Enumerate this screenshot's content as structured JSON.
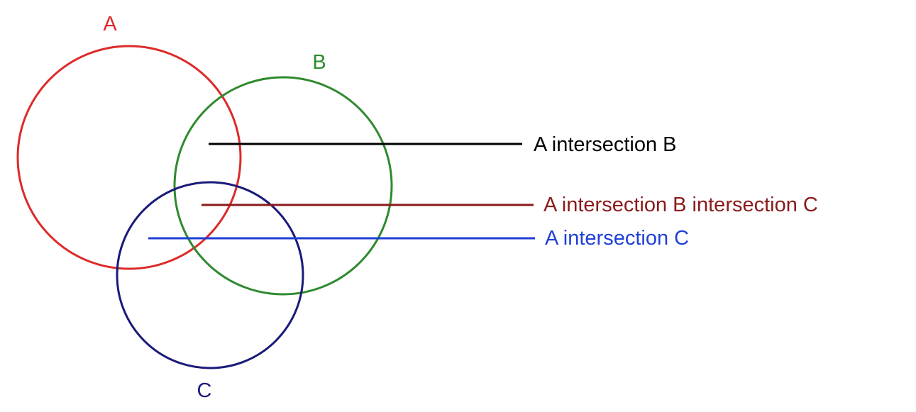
{
  "sets": [
    {
      "id": "A",
      "label": "A",
      "color": "#dd2a2a"
    },
    {
      "id": "B",
      "label": "B",
      "color": "#2f8a2f"
    },
    {
      "id": "C",
      "label": "C",
      "color": "#1a1a7a"
    }
  ],
  "callouts": [
    {
      "id": "ab",
      "text": "A intersection B",
      "color": "#000000"
    },
    {
      "id": "abc",
      "text": "A intersection B intersection C",
      "color": "#8b1a1a"
    },
    {
      "id": "ac",
      "text": "A intersection C",
      "color": "#1f3fd6"
    }
  ]
}
